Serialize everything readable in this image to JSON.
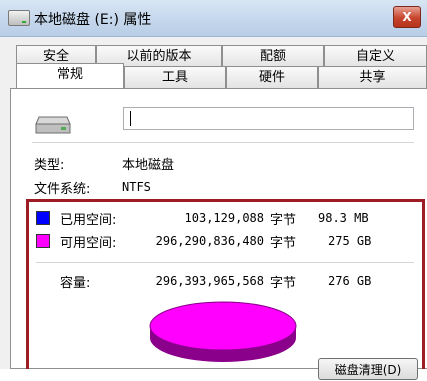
{
  "window": {
    "title": "本地磁盘 (E:) 属性",
    "close_label": "X"
  },
  "tabs_row1": [
    "安全",
    "以前的版本",
    "配额",
    "自定义"
  ],
  "tabs_row2": [
    "常规",
    "工具",
    "硬件",
    "共享"
  ],
  "active_tab": "常规",
  "general": {
    "name_value": "",
    "type_label": "类型:",
    "type_value": "本地磁盘",
    "fs_label": "文件系统:",
    "fs_value": "NTFS"
  },
  "space": {
    "used": {
      "label": "已用空间:",
      "bytes": "103,129,088",
      "unit": "字节",
      "size": "98.3 MB",
      "color": "#0000ff"
    },
    "free": {
      "label": "可用空间:",
      "bytes": "296,290,836,480",
      "unit": "字节",
      "size": "275 GB",
      "color": "#ff00ff"
    },
    "capacity": {
      "label": "容量:",
      "bytes": "296,393,965,568",
      "unit": "字节",
      "size": "276 GB"
    },
    "used_fraction": 0.00035
  },
  "cleanup_button_label": "磁盘清理(D)",
  "highlight_color": "#9e1c24",
  "icons": [
    "drive-icon",
    "close-icon",
    "title-drive-icon"
  ]
}
